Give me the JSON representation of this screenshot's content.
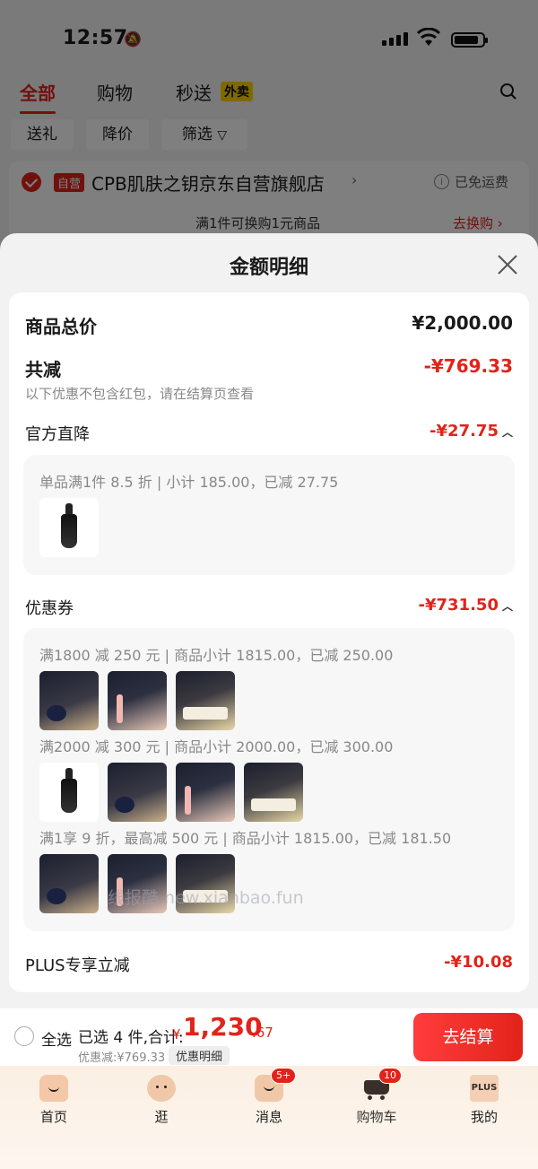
{
  "status_bar": {
    "time": "12:57"
  },
  "top_tabs": {
    "all": "全部",
    "shopping": "购物",
    "express": "秒送",
    "waimai_badge": "外卖"
  },
  "filter_chips": {
    "gift": "送礼",
    "price_drop": "降价",
    "filter": "筛选"
  },
  "store": {
    "badge": "自营",
    "name": "CPB肌肤之钥京东自营旗舰店",
    "shipping": "已免运费",
    "promo_text": "满1件可换购1元商品",
    "promo_link": "去换购"
  },
  "sheet": {
    "title": "金额明细",
    "total_label": "商品总价",
    "total_value": "¥2,000.00",
    "reduce_label": "共减",
    "reduce_value": "-¥769.33",
    "reduce_note": "以下优惠不包含红包，请在结算页查看",
    "official": {
      "label": "官方直降",
      "value": "-¥27.75",
      "line": "单品满1件 8.5 折 | 小计 185.00，已减 27.75"
    },
    "coupon": {
      "label": "优惠券",
      "value": "-¥731.50",
      "lines": [
        "满1800 减 250 元 | 商品小计 1815.00，已减 250.00",
        "满2000 减 300 元 | 商品小计 2000.00，已减 300.00",
        "满1享 9 折，最高减 500 元 | 商品小计 1815.00，已减 181.50"
      ]
    },
    "plus": {
      "label": "PLUS专享立减",
      "value": "-¥10.08"
    },
    "watermark": "线报酷 new.xianbao.fun"
  },
  "checkout": {
    "select_all": "全选",
    "selected": "已选 4 件,合计:",
    "currency": "¥",
    "total_main": "1,230",
    "total_decimal": ".67",
    "discount": "优惠减:¥769.33",
    "detail_button": "优惠明细",
    "checkout_button": "去结算"
  },
  "tabbar": {
    "home": "首页",
    "browse": "逛",
    "messages": "消息",
    "messages_badge": "5+",
    "cart": "购物车",
    "cart_badge": "10",
    "me": "我的",
    "plus_icon_text": "PLUS"
  },
  "colors": {
    "accent": "#e2231a",
    "waimai": "#ffd200"
  }
}
